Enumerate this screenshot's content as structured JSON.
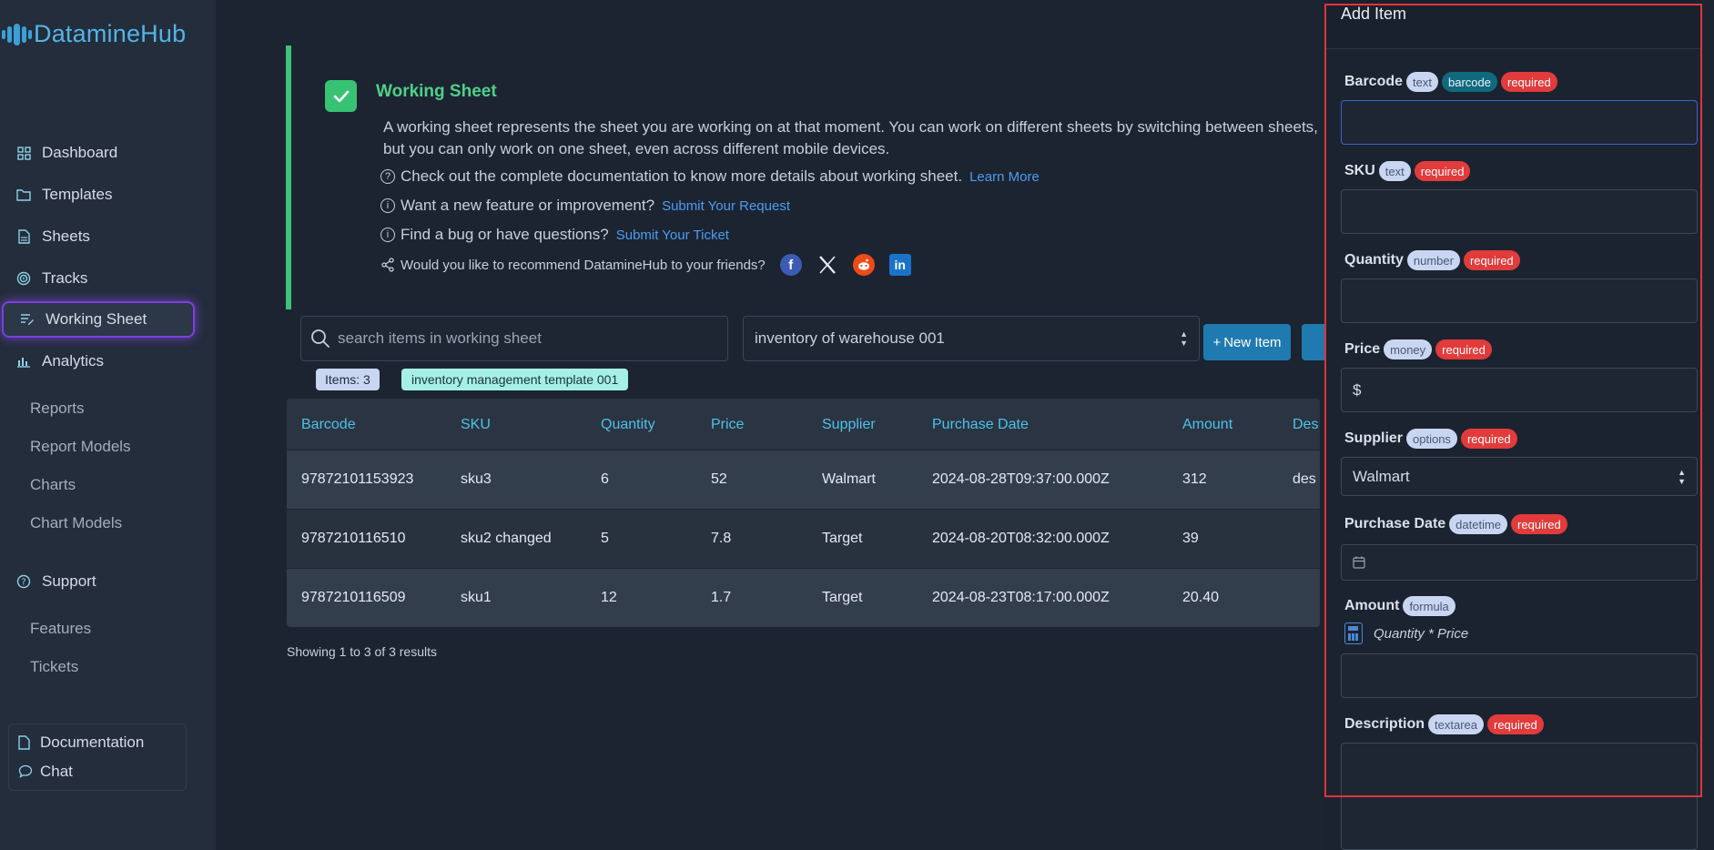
{
  "app": {
    "name": "DatamineHub"
  },
  "sidebar": {
    "nav": [
      {
        "label": "Dashboard",
        "icon": "dashboard-icon"
      },
      {
        "label": "Templates",
        "icon": "folder-icon"
      },
      {
        "label": "Sheets",
        "icon": "document-icon"
      },
      {
        "label": "Tracks",
        "icon": "tracks-icon"
      },
      {
        "label": "Working Sheet",
        "icon": "list-edit-icon",
        "active": true
      },
      {
        "label": "Analytics",
        "icon": "bar-chart-icon"
      }
    ],
    "analytics_sub": [
      "Reports",
      "Report Models",
      "Charts",
      "Chart Models"
    ],
    "support": {
      "label": "Support",
      "icon": "help-circle-icon"
    },
    "support_sub": [
      "Features",
      "Tickets"
    ],
    "bottom": [
      {
        "label": "Documentation",
        "icon": "document-icon"
      },
      {
        "label": "Chat",
        "icon": "chat-bubble-icon"
      }
    ]
  },
  "info": {
    "title": "Working Sheet",
    "description": "A working sheet represents the sheet you are working on at that moment. You can work on different sheets by switching between sheets, but you can only work on one sheet, even across different mobile devices.",
    "docs_text": "Check out the complete documentation to know more details about working sheet.",
    "docs_link": "Learn More",
    "feature_text": "Want a new feature or improvement?",
    "feature_link": "Submit Your Request",
    "bug_text": "Find a bug or have questions?",
    "bug_link": "Submit Your Ticket",
    "share_text": "Would you like to recommend DatamineHub to your friends?"
  },
  "toolbar": {
    "search_placeholder": "search items in working sheet",
    "sheet_select": "inventory of warehouse 001",
    "new_item_label": "New Item",
    "items_badge": "Items: 3",
    "template_badge": "inventory management template 001"
  },
  "table": {
    "columns": [
      "Barcode",
      "SKU",
      "Quantity",
      "Price",
      "Supplier",
      "Purchase Date",
      "Amount",
      "Des"
    ],
    "rows": [
      [
        "97872101153923",
        "sku3",
        "6",
        "52",
        "Walmart",
        "2024-08-28T09:37:00.000Z",
        "312",
        "des"
      ],
      [
        "9787210116510",
        "sku2 changed",
        "5",
        "7.8",
        "Target",
        "2024-08-20T08:32:00.000Z",
        "39",
        ""
      ],
      [
        "9787210116509",
        "sku1",
        "12",
        "1.7",
        "Target",
        "2024-08-23T08:17:00.000Z",
        "20.40",
        ""
      ]
    ],
    "showing": "Showing 1 to 3 of 3 results"
  },
  "panel": {
    "title": "Add Item",
    "fields": [
      {
        "label": "Barcode",
        "type": "text",
        "extra": "barcode",
        "required": "required",
        "value": ""
      },
      {
        "label": "SKU",
        "type": "text",
        "required": "required",
        "value": ""
      },
      {
        "label": "Quantity",
        "type": "number",
        "required": "required",
        "value": ""
      },
      {
        "label": "Price",
        "type": "money",
        "required": "required",
        "value": "$"
      },
      {
        "label": "Supplier",
        "type": "options",
        "required": "required",
        "value": "Walmart"
      },
      {
        "label": "Purchase Date",
        "type": "datetime",
        "required": "required",
        "value": ""
      },
      {
        "label": "Amount",
        "type": "formula",
        "formula": "Quantity * Price",
        "value": ""
      },
      {
        "label": "Description",
        "type": "textarea",
        "required": "required",
        "value": ""
      }
    ]
  },
  "colors": {
    "accent": "#4fc1e8",
    "success": "#3ec27a",
    "required": "#e23b3b",
    "primary_button": "#1f7ab0",
    "active_glow": "#7b3fe4",
    "panel_outline": "#e0343a"
  }
}
